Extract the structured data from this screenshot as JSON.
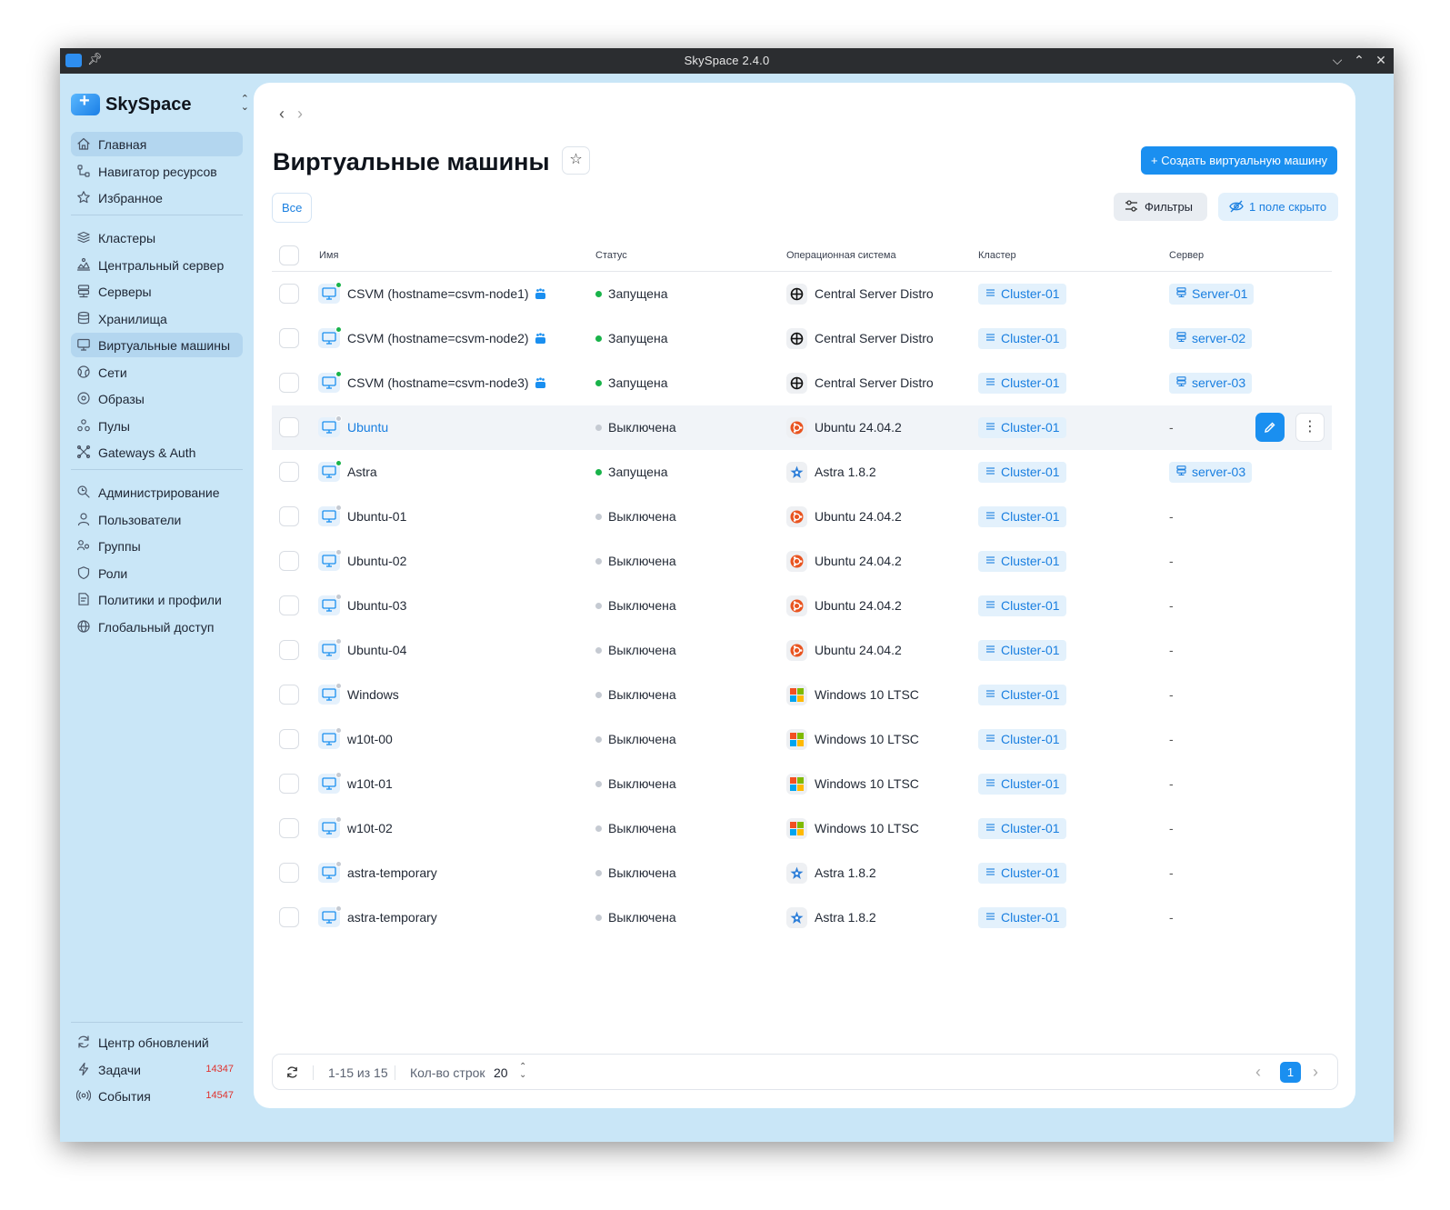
{
  "window": {
    "title": "SkySpace 2.4.0"
  },
  "sidebar": {
    "logo": "SkySpace",
    "sections": [
      [
        {
          "label": "Главная",
          "icon": "home-icon",
          "active": true
        },
        {
          "label": "Навигатор ресурсов",
          "icon": "navigator-icon"
        },
        {
          "label": "Избранное",
          "icon": "star-icon"
        }
      ],
      [
        {
          "label": "Кластеры",
          "icon": "cluster-icon"
        },
        {
          "label": "Центральный сервер",
          "icon": "central-server-icon"
        },
        {
          "label": "Серверы",
          "icon": "server-icon"
        },
        {
          "label": "Хранилища",
          "icon": "storage-icon"
        },
        {
          "label": "Виртуальные машины",
          "icon": "monitor-icon",
          "active": true
        },
        {
          "label": "Сети",
          "icon": "network-icon"
        },
        {
          "label": "Образы",
          "icon": "disc-icon"
        },
        {
          "label": "Пулы",
          "icon": "pool-icon"
        },
        {
          "label": "Gateways & Auth",
          "icon": "gateway-icon"
        }
      ],
      [
        {
          "label": "Администрирование",
          "icon": "admin-icon"
        },
        {
          "label": "Пользователи",
          "icon": "user-icon"
        },
        {
          "label": "Группы",
          "icon": "group-icon"
        },
        {
          "label": "Роли",
          "icon": "shield-icon"
        },
        {
          "label": "Политики и профили",
          "icon": "policy-icon"
        },
        {
          "label": "Глобальный доступ",
          "icon": "globe-icon"
        }
      ]
    ],
    "bottom": [
      {
        "label": "Центр обновлений",
        "icon": "refresh-icon"
      },
      {
        "label": "Задачи",
        "icon": "bolt-icon",
        "badge": "14347"
      },
      {
        "label": "События",
        "icon": "events-icon",
        "badge": "14547"
      }
    ]
  },
  "page": {
    "title": "Виртуальные машины",
    "create_label": "Создать виртуальную машину",
    "all_label": "Все",
    "filters_label": "Фильтры",
    "hidden_label": "1 поле скрыто"
  },
  "table": {
    "columns": [
      "Имя",
      "Статус",
      "Операционная система",
      "Кластер",
      "Сервер"
    ],
    "rows": [
      {
        "name": "CSVM (hostname=csvm-node1)",
        "csvm": true,
        "running": true,
        "status": "Запущена",
        "os": "Central Server Distro",
        "os_icon": "central-os",
        "cluster": "Cluster-01",
        "server": "Server-01"
      },
      {
        "name": "CSVM (hostname=csvm-node2)",
        "csvm": true,
        "running": true,
        "status": "Запущена",
        "os": "Central Server Distro",
        "os_icon": "central-os",
        "cluster": "Cluster-01",
        "server": "server-02"
      },
      {
        "name": "CSVM (hostname=csvm-node3)",
        "csvm": true,
        "running": true,
        "status": "Запущена",
        "os": "Central Server Distro",
        "os_icon": "central-os",
        "cluster": "Cluster-01",
        "server": "server-03"
      },
      {
        "name": "Ubuntu",
        "running": false,
        "hover": true,
        "status": "Выключена",
        "os": "Ubuntu 24.04.2",
        "os_icon": "ubuntu",
        "cluster": "Cluster-01",
        "server": "-"
      },
      {
        "name": "Astra",
        "running": true,
        "status": "Запущена",
        "os": "Astra 1.8.2",
        "os_icon": "astra",
        "cluster": "Cluster-01",
        "server": "server-03"
      },
      {
        "name": "Ubuntu-01",
        "running": false,
        "status": "Выключена",
        "os": "Ubuntu 24.04.2",
        "os_icon": "ubuntu",
        "cluster": "Cluster-01",
        "server": "-"
      },
      {
        "name": "Ubuntu-02",
        "running": false,
        "status": "Выключена",
        "os": "Ubuntu 24.04.2",
        "os_icon": "ubuntu",
        "cluster": "Cluster-01",
        "server": "-"
      },
      {
        "name": "Ubuntu-03",
        "running": false,
        "status": "Выключена",
        "os": "Ubuntu 24.04.2",
        "os_icon": "ubuntu",
        "cluster": "Cluster-01",
        "server": "-"
      },
      {
        "name": "Ubuntu-04",
        "running": false,
        "status": "Выключена",
        "os": "Ubuntu 24.04.2",
        "os_icon": "ubuntu",
        "cluster": "Cluster-01",
        "server": "-"
      },
      {
        "name": "Windows",
        "running": false,
        "status": "Выключена",
        "os": "Windows 10 LTSC",
        "os_icon": "windows",
        "cluster": "Cluster-01",
        "server": "-"
      },
      {
        "name": "w10t-00",
        "running": false,
        "status": "Выключена",
        "os": "Windows 10 LTSC",
        "os_icon": "windows",
        "cluster": "Cluster-01",
        "server": "-"
      },
      {
        "name": "w10t-01",
        "running": false,
        "status": "Выключена",
        "os": "Windows 10 LTSC",
        "os_icon": "windows",
        "cluster": "Cluster-01",
        "server": "-"
      },
      {
        "name": "w10t-02",
        "running": false,
        "status": "Выключена",
        "os": "Windows 10 LTSC",
        "os_icon": "windows",
        "cluster": "Cluster-01",
        "server": "-"
      },
      {
        "name": "astra-temporary",
        "running": false,
        "status": "Выключена",
        "os": "Astra 1.8.2",
        "os_icon": "astra",
        "cluster": "Cluster-01",
        "server": "-"
      },
      {
        "name": "astra-temporary",
        "running": false,
        "status": "Выключена",
        "os": "Astra 1.8.2",
        "os_icon": "astra",
        "cluster": "Cluster-01",
        "server": "-"
      }
    ]
  },
  "footer": {
    "range": "1-15 из 15",
    "rows_label": "Кол-во строк",
    "rows_value": "20",
    "page": "1"
  },
  "colors": {
    "accent": "#1a8ff0",
    "running": "#19b34a",
    "stopped": "#c5cad2",
    "sidebar_bg": "#c9e6f7",
    "badge": "#e0312d"
  }
}
